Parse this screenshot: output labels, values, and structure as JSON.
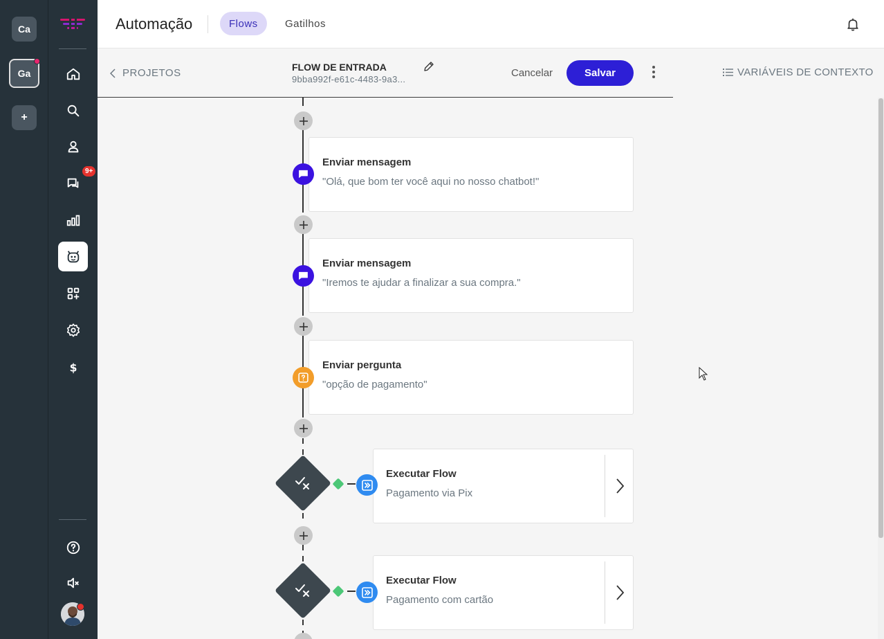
{
  "workspaces": [
    {
      "label": "Ca",
      "active": false,
      "notification": false
    },
    {
      "label": "Ga",
      "active": true,
      "notification": true
    },
    {
      "label": "+",
      "active": false,
      "notification": false
    }
  ],
  "nav": {
    "items": [
      {
        "name": "home",
        "icon": "home-icon",
        "active": false
      },
      {
        "name": "search",
        "icon": "search-icon",
        "active": false
      },
      {
        "name": "contacts",
        "icon": "user-icon",
        "active": false
      },
      {
        "name": "conversations",
        "icon": "chat-icon",
        "active": false,
        "badge": "9+"
      },
      {
        "name": "reports",
        "icon": "bar-chart-icon",
        "active": false
      },
      {
        "name": "automation",
        "icon": "bot-icon",
        "active": true
      },
      {
        "name": "apps",
        "icon": "apps-add-icon",
        "active": false
      },
      {
        "name": "settings",
        "icon": "gear-icon",
        "active": false
      },
      {
        "name": "billing",
        "icon": "dollar-icon",
        "active": false
      }
    ],
    "bottom": [
      {
        "name": "help",
        "icon": "help-icon"
      },
      {
        "name": "sound",
        "icon": "sound-muted-icon"
      }
    ]
  },
  "header": {
    "title": "Automação",
    "tabs": [
      {
        "label": "Flows",
        "active": true
      },
      {
        "label": "Gatilhos",
        "active": false
      }
    ]
  },
  "subheader": {
    "back_label": "PROJETOS",
    "flow_name": "FLOW DE ENTRADA",
    "flow_id": "9bba992f-e61c-4483-9a3...",
    "cancel_label": "Cancelar",
    "save_label": "Salvar",
    "context_vars_label": "VARIÁVEIS DE CONTEXTO"
  },
  "flow": {
    "nodes": [
      {
        "type": "message",
        "title": "Enviar mensagem",
        "text": "\"Olá, que bom ter você aqui no nosso chatbot!\""
      },
      {
        "type": "message",
        "title": "Enviar mensagem",
        "text": "\"Iremos te ajudar a finalizar a sua compra.\""
      },
      {
        "type": "question",
        "title": "Enviar pergunta",
        "text": "\"opção de pagamento\""
      },
      {
        "type": "execute",
        "title": "Executar Flow",
        "text": "Pagamento via Pix"
      },
      {
        "type": "execute",
        "title": "Executar Flow",
        "text": "Pagamento com cartão"
      }
    ]
  },
  "colors": {
    "sidebar": "#26323a",
    "accent": "#2d1fd6",
    "message_icon": "#3b12e0",
    "question_icon": "#f29d2a",
    "execute_icon": "#2f8bf0",
    "condition_dot": "#4cc777",
    "badge": "#e5322d"
  }
}
